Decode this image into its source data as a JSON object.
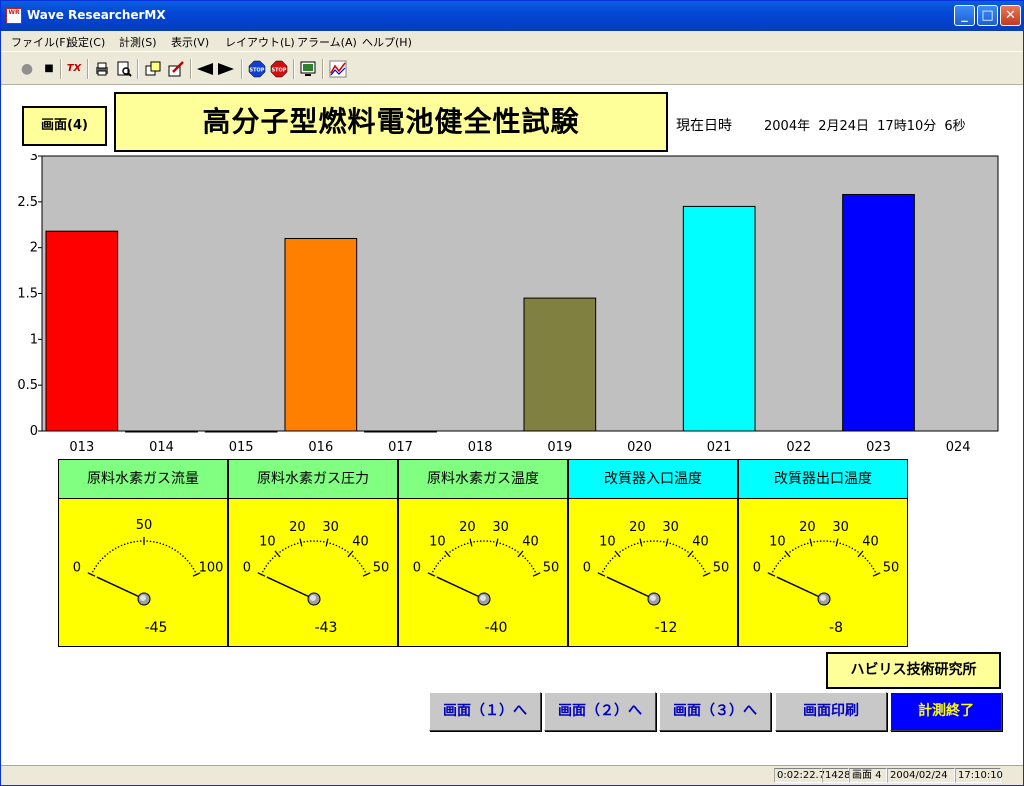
{
  "window": {
    "title": "Wave ResearcherMX",
    "icon_text": "WR"
  },
  "window_controls": {
    "minimize": "_",
    "maximize": "□",
    "close": "✕"
  },
  "menu": [
    "ファイル(F)",
    "設定(C)",
    "計測(S)",
    "表示(V)",
    "レイアウト(L)",
    "アラーム(A)",
    "ヘルプ(H)"
  ],
  "toolbar": {
    "items": [
      "record-dot-icon",
      "stop-square-icon",
      "tx-icon",
      "print-icon",
      "print-preview-icon",
      "copy-icon",
      "edit-icon",
      "back-arrow-icon",
      "forward-arrow-icon",
      "stop-blue-icon",
      "stop-red-icon",
      "monitor-icon",
      "graph-icon"
    ],
    "tx_label": "TX",
    "stop_label": "STOP"
  },
  "header": {
    "screen_badge": "画面(4)",
    "title": "高分子型燃料電池健全性試験",
    "datetime_label": "現在日時",
    "datetime_value": "2004年 2月24日 17時10分 6秒"
  },
  "chart_data": {
    "type": "bar",
    "categories": [
      "013",
      "014",
      "015",
      "016",
      "017",
      "018",
      "019",
      "020",
      "021",
      "022",
      "023",
      "024"
    ],
    "values": [
      2.18,
      0,
      0,
      2.1,
      0,
      null,
      1.45,
      null,
      2.45,
      null,
      2.58,
      null
    ],
    "colors": [
      "#ff0000",
      "#000000",
      "#000000",
      "#ff8000",
      "#000000",
      null,
      "#808040",
      null,
      "#00ffff",
      null,
      "#0000ff",
      null
    ],
    "yticks": [
      "0",
      "0.5",
      "1",
      "1.5",
      "2",
      "2.5",
      "3"
    ],
    "ylim": [
      0,
      3
    ],
    "plot_background": "#c0c0c0",
    "grid": false
  },
  "gauges": [
    {
      "label": "原料水素ガス流量",
      "label_bg": "#80ff80",
      "ticks": [
        "0",
        "50",
        "100"
      ],
      "value": "-45"
    },
    {
      "label": "原料水素ガス圧力",
      "label_bg": "#80ff80",
      "ticks": [
        "0",
        "10",
        "20",
        "30",
        "40",
        "50"
      ],
      "value": "-43"
    },
    {
      "label": "原料水素ガス温度",
      "label_bg": "#80ff80",
      "ticks": [
        "0",
        "10",
        "20",
        "30",
        "40",
        "50"
      ],
      "value": "-40"
    },
    {
      "label": "改質器入口温度",
      "label_bg": "#00ffff",
      "ticks": [
        "0",
        "10",
        "20",
        "30",
        "40",
        "50"
      ],
      "value": "-12"
    },
    {
      "label": "改質器出口温度",
      "label_bg": "#00ffff",
      "ticks": [
        "0",
        "10",
        "20",
        "30",
        "40",
        "50"
      ],
      "value": "-8"
    }
  ],
  "footer": {
    "lab_name": "ハビリス技術研究所",
    "buttons": [
      "画面（１）へ",
      "画面（２）へ",
      "画面（３）へ",
      "画面印刷",
      "計測終了"
    ]
  },
  "status_bar": [
    "0:02:22.7",
    "1428",
    "画面 4",
    "2004/02/24",
    "17:10:10"
  ]
}
